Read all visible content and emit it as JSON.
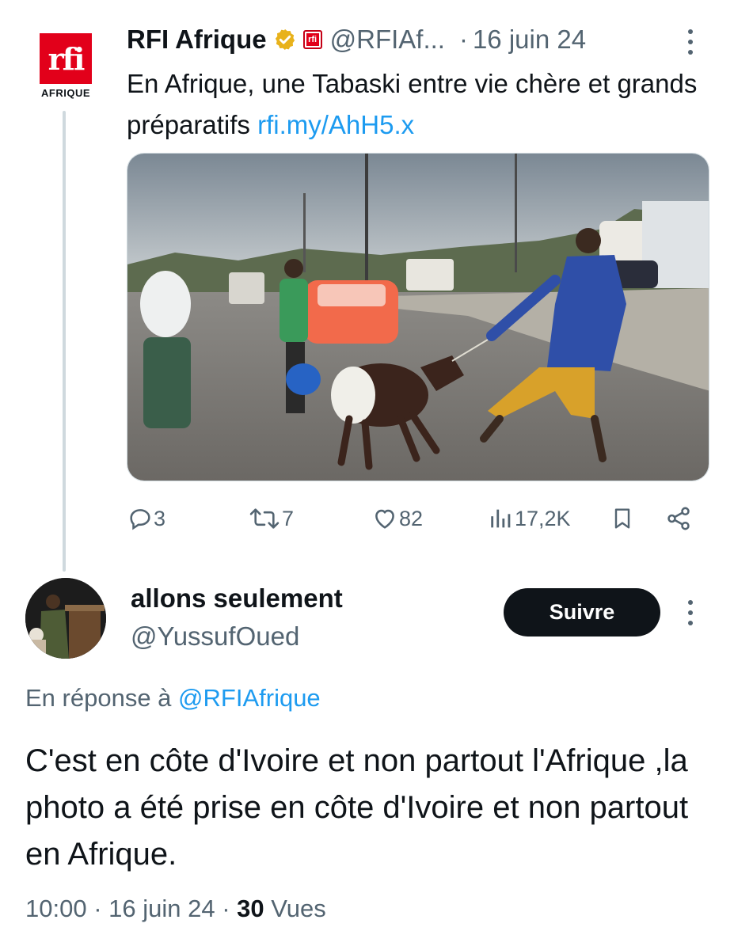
{
  "original_tweet": {
    "logo_text": "rfi",
    "logo_subtext": "AFRIQUE",
    "name": "RFI Afrique",
    "handle": "@RFIAf...",
    "date": "16 juin 24",
    "text": "En Afrique, une Tabaski entre vie chère et grands préparatifs",
    "link": "rfi.my/AhH5.x",
    "actions": {
      "replies": "3",
      "retweets": "7",
      "likes": "82",
      "views": "17,2K"
    }
  },
  "reply": {
    "name": "allons seulement",
    "handle": "@YussufOued",
    "follow_label": "Suivre",
    "in_reply_prefix": "En réponse à",
    "in_reply_handle": "@RFIAfrique",
    "text": "C'est en côte d'Ivoire et non partout l'Afrique ,la photo  a été prise en côte d'Ivoire et non partout en Afrique.",
    "time": "10:00",
    "date": "16 juin 24",
    "views_count": "30",
    "views_label": "Vues"
  },
  "colors": {
    "link": "#1d9bf0",
    "secondary_text": "#536471",
    "rfi_red": "#e2001a",
    "verified_gold": "#e8b21b"
  },
  "icons": [
    "reply-icon",
    "retweet-icon",
    "like-icon",
    "views-icon",
    "bookmark-icon",
    "share-icon",
    "verified-badge-icon",
    "more-icon"
  ]
}
